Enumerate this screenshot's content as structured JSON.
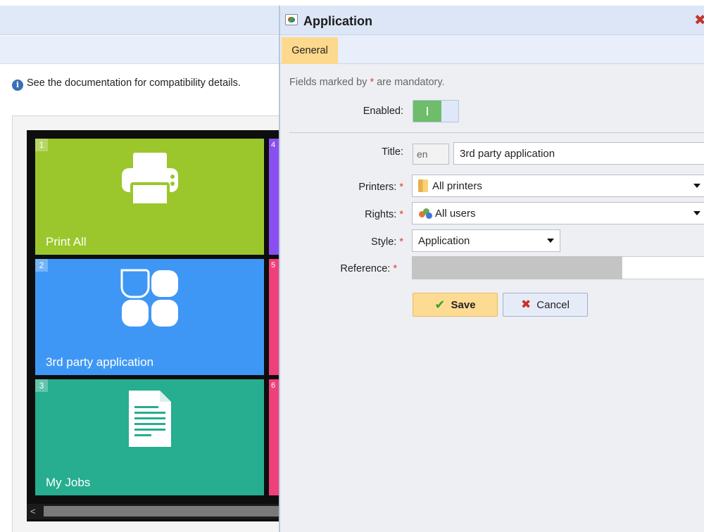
{
  "info": {
    "text": "See the documentation for compatibility details."
  },
  "preview": {
    "tiles": [
      {
        "num": "1",
        "label": "Print All",
        "color": "#9bc72c",
        "icon": "printer-icon"
      },
      {
        "num": "2",
        "label": "3rd party application",
        "color": "#3f97f5",
        "icon": "application-icon"
      },
      {
        "num": "3",
        "label": "My Jobs",
        "color": "#27ad8f",
        "icon": "document-icon"
      }
    ],
    "side_tiles": [
      {
        "num": "4",
        "color": "#8a4ff0"
      },
      {
        "num": "5",
        "color": "#f0407a"
      },
      {
        "num": "6",
        "color": "#f0407a"
      }
    ],
    "scroll_left": "<"
  },
  "dialog": {
    "title": "Application",
    "tab_general": "General",
    "mandatory_prefix": "Fields marked by ",
    "mandatory_star": "*",
    "mandatory_suffix": " are mandatory.",
    "enabled_label": "Enabled:",
    "title_label": "Title:",
    "title_lang": "en",
    "title_value": "3rd party application",
    "printers_label": "Printers:",
    "printers_value": "All printers",
    "rights_label": "Rights:",
    "rights_value": "All users",
    "style_label": "Style:",
    "style_value": "Application",
    "reference_label": "Reference:",
    "star": "*",
    "save_label": "Save",
    "cancel_label": "Cancel",
    "enabled": true
  },
  "colors": {
    "accent_tab": "#fcd98c",
    "required": "#d9402d",
    "toggle_on": "#6dbd6a"
  }
}
